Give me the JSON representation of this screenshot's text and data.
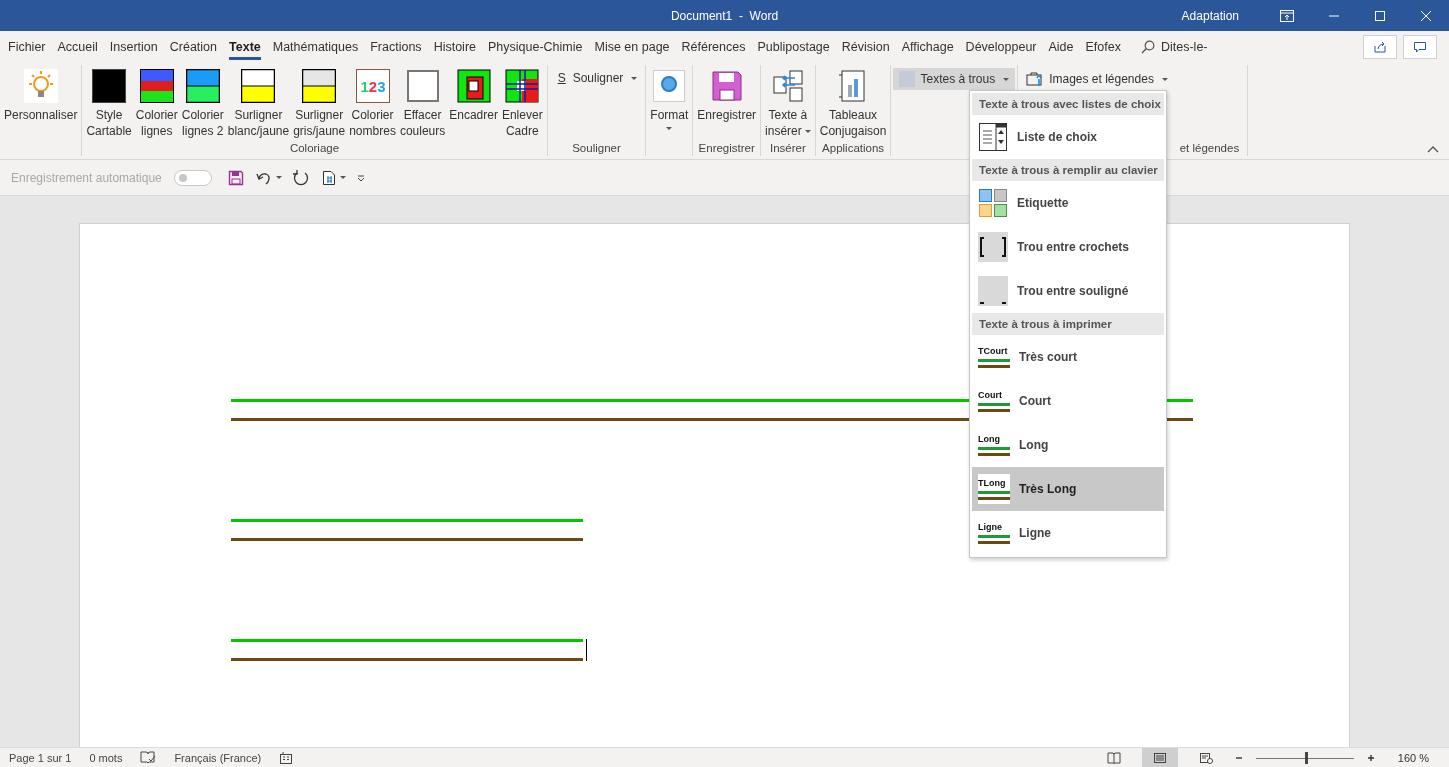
{
  "title_bar": {
    "title": "Document1  -  Word",
    "user": "Adaptation"
  },
  "tabs": [
    {
      "label": "Fichier",
      "selected": false
    },
    {
      "label": "Accueil",
      "selected": false
    },
    {
      "label": "Insertion",
      "selected": false
    },
    {
      "label": "Création",
      "selected": false
    },
    {
      "label": "Texte",
      "selected": true
    },
    {
      "label": "Mathématiques",
      "selected": false
    },
    {
      "label": "Fractions",
      "selected": false
    },
    {
      "label": "Histoire",
      "selected": false
    },
    {
      "label": "Physique-Chimie",
      "selected": false
    },
    {
      "label": "Mise en page",
      "selected": false
    },
    {
      "label": "Références",
      "selected": false
    },
    {
      "label": "Publipostage",
      "selected": false
    },
    {
      "label": "Révision",
      "selected": false
    },
    {
      "label": "Affichage",
      "selected": false
    },
    {
      "label": "Développeur",
      "selected": false
    },
    {
      "label": "Aide",
      "selected": false
    },
    {
      "label": "Efofex",
      "selected": false
    }
  ],
  "tell_me": {
    "placeholder": "Dites-le-"
  },
  "ribbon": {
    "groups": [
      {
        "buttons": [
          {
            "kind": "bulb",
            "lines": [
              "Personnaliser"
            ]
          }
        ]
      },
      {
        "label": "Coloriage",
        "buttons": [
          {
            "kind": "black",
            "lines": [
              "Style",
              "Cartable"
            ]
          },
          {
            "kind": "lines3",
            "lines": [
              "Colorier",
              "lignes"
            ]
          },
          {
            "kind": "lines2",
            "lines": [
              "Colorier",
              "lignes 2"
            ]
          },
          {
            "kind": "hl-white",
            "lines": [
              "Surligner",
              "blanc/jaune"
            ]
          },
          {
            "kind": "hl-grey",
            "lines": [
              "Surligner",
              "gris/jaune"
            ]
          },
          {
            "kind": "numbers",
            "digits": [
              {
                "t": "1",
                "color": "#2ecc71"
              },
              {
                "t": "2",
                "color": "#e8334a"
              },
              {
                "t": "3",
                "color": "#1fa8e0"
              }
            ],
            "lines": [
              "Colorier",
              "nombres"
            ]
          },
          {
            "kind": "empty",
            "lines": [
              "Effacer",
              "couleurs"
            ]
          },
          {
            "kind": "frame",
            "lines": [
              "Encadrer"
            ]
          },
          {
            "kind": "unframe",
            "lines": [
              "Enlever",
              "Cadre"
            ]
          }
        ]
      },
      {
        "label": "Souligner",
        "buttons": [
          {
            "kind": "underline",
            "icon_text": "S",
            "lines": [
              "Souligner"
            ],
            "dropdown": true
          }
        ]
      },
      {
        "buttons": [
          {
            "kind": "format",
            "lines": [
              "Format"
            ],
            "dropdown": true
          }
        ]
      },
      {
        "label": "Enregistrer",
        "buttons": [
          {
            "kind": "save",
            "lines": [
              "Enregistrer"
            ]
          }
        ]
      },
      {
        "label": "Insérer",
        "buttons": [
          {
            "kind": "insert",
            "lines": [
              "Texte à",
              "insérer"
            ],
            "dropdown": true
          }
        ]
      },
      {
        "label": "Applications",
        "buttons": [
          {
            "kind": "table",
            "lines": [
              "Tableaux",
              "Conjugaison"
            ]
          }
        ]
      },
      {
        "buttons": [
          {
            "kind": "square",
            "lines": [
              "Textes à trous"
            ],
            "dropdown": true,
            "expanded": true
          }
        ]
      },
      {
        "label": "et légendes",
        "buttons": [
          {
            "kind": "toolbox",
            "lines": [
              "Images et légendes"
            ],
            "dropdown": true
          }
        ]
      }
    ]
  },
  "quick_access": {
    "autosave_label": "Enregistrement automatique",
    "autosave_on": false
  },
  "document": {
    "blanks": [
      {
        "kind": "full"
      },
      {
        "kind": "short"
      },
      {
        "kind": "short"
      }
    ]
  },
  "menu": {
    "sections": [
      {
        "header": "Texte à trous avec listes de choix",
        "items": [
          {
            "kind": "choice-list",
            "label": "Liste de choix",
            "selected": false
          }
        ]
      },
      {
        "header": "Texte à trous à remplir au clavier",
        "items": [
          {
            "kind": "tiles",
            "label": "Etiquette",
            "selected": false
          },
          {
            "kind": "brackets",
            "label": "Trou entre crochets",
            "selected": false
          },
          {
            "kind": "underline-hole",
            "label": "Trou entre souligné",
            "selected": false
          }
        ]
      },
      {
        "header": "Texte à trous à imprimer",
        "items": [
          {
            "kind": "blank-lines",
            "icon_text": "TCourt",
            "label": "Très court",
            "selected": false
          },
          {
            "kind": "blank-lines",
            "icon_text": "Court",
            "label": "Court",
            "selected": false
          },
          {
            "kind": "blank-lines",
            "icon_text": "Long",
            "label": "Long",
            "selected": false
          },
          {
            "kind": "blank-lines",
            "icon_text": "TLong",
            "label": "Très Long",
            "selected": true
          },
          {
            "kind": "blank-lines",
            "icon_text": "Ligne",
            "label": "Ligne",
            "selected": false
          }
        ]
      }
    ]
  },
  "status_bar": {
    "page": "Page 1 sur 1",
    "words": "0 mots",
    "language": "Français (France)",
    "views": [
      {
        "kind": "read",
        "selected": false
      },
      {
        "kind": "print",
        "selected": true
      },
      {
        "kind": "web",
        "selected": false
      }
    ],
    "zoom": {
      "level": 0.5,
      "reading": "160 %"
    }
  }
}
